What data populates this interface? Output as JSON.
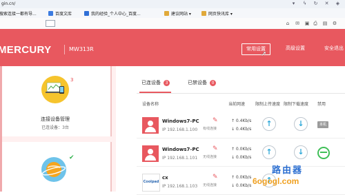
{
  "browser": {
    "address_text": "gin.cn/",
    "bookmarks": [
      {
        "label": "搜索连接一都有导..."
      },
      {
        "label": "百度文库"
      },
      {
        "label": "我的经验_个人中心_百度..."
      },
      {
        "label": "建议网站 ▾"
      },
      {
        "label": "网页快讯库 ▾"
      }
    ]
  },
  "header": {
    "brand": "MERCURY",
    "model": "MW313R",
    "nav": {
      "common_settings": "常用设置",
      "advanced_settings": "高级设置",
      "safe_exit": "安全退出"
    }
  },
  "sidebar": {
    "devices_card": {
      "badge": "3",
      "title": "连接设备管理",
      "subtitle": "已连设备：3台"
    }
  },
  "main": {
    "tabs": {
      "connected_label": "已连设备",
      "connected_count": "3",
      "blocked_label": "已禁设备",
      "blocked_count": "0"
    },
    "columns": {
      "device_name": "设备名称",
      "current_rate": "当前网速",
      "limit_upload": "限制上传速度",
      "limit_download": "限制下载速度",
      "ban": "禁用"
    },
    "devices": [
      {
        "name": "Windows7-PC",
        "ip": "IP 192.168.1.100",
        "conn": "有线连接",
        "up": "↑ 0.4Kb/s",
        "down": "↓ 0.4Kb/s",
        "tag": "本机"
      },
      {
        "name": "Windows7-PC",
        "ip": "IP 192.168.1.101",
        "conn": "无线连接",
        "up": "↑ 0.0Kb/s",
        "down": "↓ 0.0Kb/s",
        "tag": ""
      },
      {
        "name": "cx",
        "ip": "IP 192.168.1.103",
        "conn": "无线连接",
        "up": "↑ 0.0Kb/s",
        "down": "↓ 0.0Kb/s",
        "tag": ""
      }
    ],
    "coolpad_logo": "Coolpad"
  },
  "watermark": {
    "line1": "路由器",
    "line2": "6ogogl.com"
  },
  "colors": {
    "brand_red": "#e8585f",
    "arrow_blue": "#2fa8d8",
    "ok_green": "#3fbf57"
  }
}
